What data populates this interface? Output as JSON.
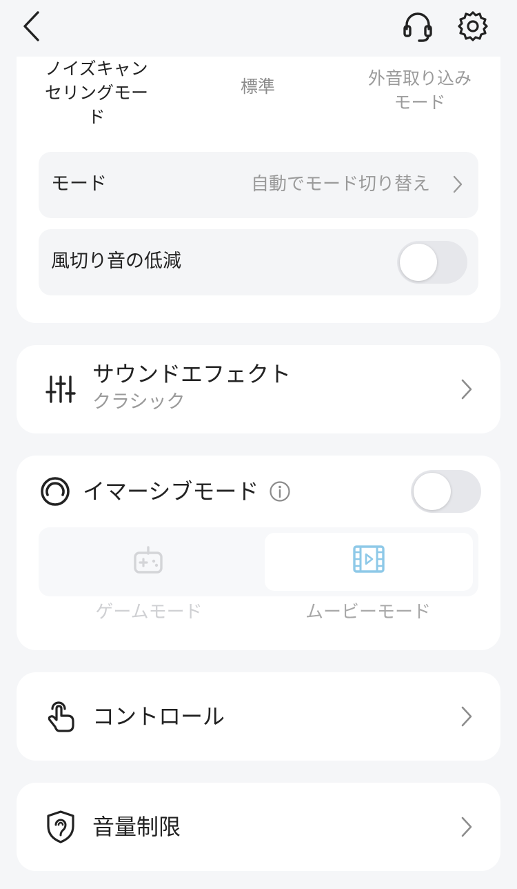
{
  "top_bar": {
    "back_icon": "chevron-left-icon",
    "headset_icon": "headset-icon",
    "settings_icon": "gear-icon"
  },
  "anc": {
    "tabs": [
      {
        "label": "ノイズキャンセリングモード",
        "state": "selected"
      },
      {
        "label": "標準",
        "state": "unselected"
      },
      {
        "label": "外音取り込みモード",
        "state": "unselected"
      }
    ],
    "mode_row": {
      "label": "モード",
      "value": "自動でモード切り替え"
    },
    "wind_row": {
      "label": "風切り音の低減",
      "toggle_on": false
    }
  },
  "sound_effect": {
    "title": "サウンドエフェクト",
    "subtitle": "クラシック",
    "icon": "equalizer-icon"
  },
  "immersive": {
    "title": "イマーシブモード",
    "toggle_on": false,
    "icon": "immersive-ring-icon",
    "options": [
      {
        "label": "ゲームモード",
        "icon": "gamepad-icon",
        "selected": false
      },
      {
        "label": "ムービーモード",
        "icon": "film-icon",
        "selected": true
      }
    ]
  },
  "control": {
    "title": "コントロール",
    "icon": "touch-hand-icon"
  },
  "volume_limit": {
    "title": "音量制限",
    "icon": "ear-shield-icon"
  },
  "colors": {
    "background": "#f5f6f8",
    "card": "#ffffff",
    "text_primary": "#222222",
    "text_secondary": "#9a9a9a",
    "accent_film": "#8ec9e8"
  }
}
